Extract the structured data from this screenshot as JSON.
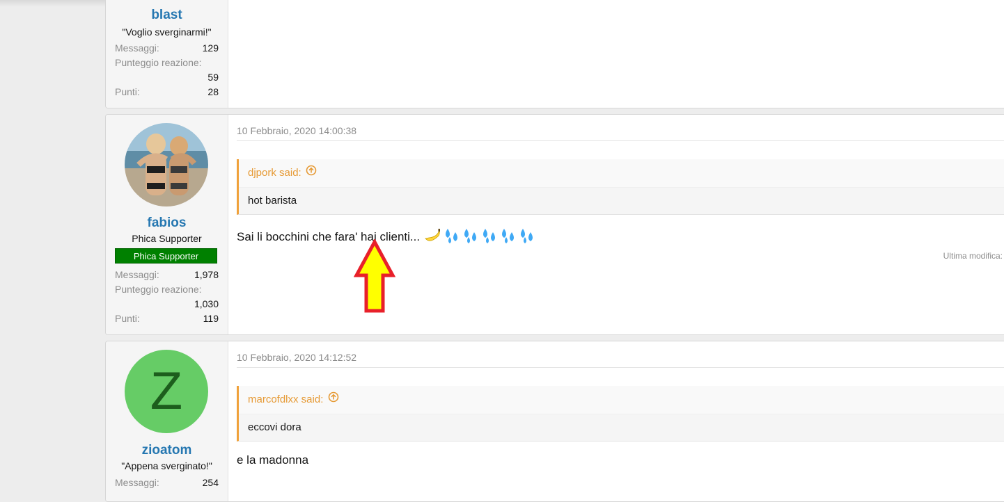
{
  "posts": [
    {
      "username": "blast",
      "user_title": "\"Voglio sverginarmi!\"",
      "stats": [
        {
          "label": "Messaggi:",
          "value": "129"
        },
        {
          "label": "Punteggio reazione:",
          "value": "59"
        },
        {
          "label": "Punti:",
          "value": "28"
        }
      ]
    },
    {
      "username": "fabios",
      "user_title": "Phica Supporter",
      "banner": "Phica Supporter",
      "date": "10 Febbraio, 2020 14:00:38",
      "quote_author": "djpork said:",
      "quote_text": "hot barista",
      "message": "Sai li bocchini che fara' hai clienti...",
      "last_edit": "Ultima modifica:",
      "stats": [
        {
          "label": "Messaggi:",
          "value": "1,978"
        },
        {
          "label": "Punteggio reazione:",
          "value": "1,030"
        },
        {
          "label": "Punti:",
          "value": "119"
        }
      ]
    },
    {
      "username": "zioatom",
      "avatar_letter": "Z",
      "user_title": "\"Appena sverginato!\"",
      "date": "10 Febbraio, 2020 14:12:52",
      "quote_author": "marcofdlxx said:",
      "quote_text": "eccovi dora",
      "message": "e la madonna",
      "stats": [
        {
          "label": "Messaggi:",
          "value": "254"
        }
      ]
    }
  ],
  "icons": {
    "quote_jump": "circle-arrow-up-icon",
    "emoji": [
      "banana-emoji-icon",
      "sweat-droplets-icon",
      "sweat-droplets-icon",
      "sweat-droplets-icon",
      "sweat-droplets-icon",
      "sweat-droplets-icon"
    ],
    "annotation": "red-yellow-up-arrow"
  },
  "colors": {
    "username": "#2577b1",
    "quote_accent": "#f0a13a",
    "banner_bg": "#008000",
    "avatar_z_bg": "#66cc66",
    "annotation_outline": "#e8202a",
    "annotation_fill": "#ffff00"
  }
}
